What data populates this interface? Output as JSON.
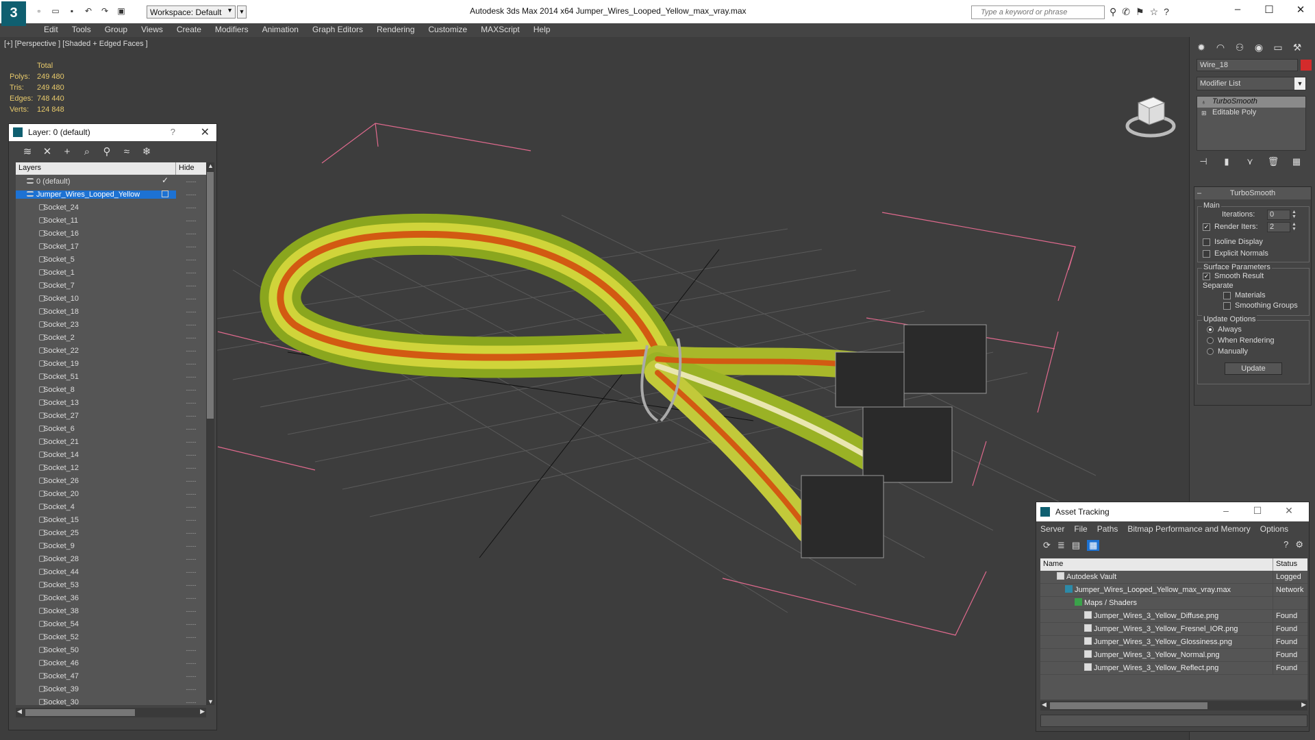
{
  "titlebar": {
    "workspace": "Workspace: Default",
    "app_title": "Autodesk 3ds Max  2014 x64       Jumper_Wires_Looped_Yellow_max_vray.max",
    "search_placeholder": "Type a keyword or phrase"
  },
  "menu": [
    "Edit",
    "Tools",
    "Group",
    "Views",
    "Create",
    "Modifiers",
    "Animation",
    "Graph Editors",
    "Rendering",
    "Customize",
    "MAXScript",
    "Help"
  ],
  "viewport": {
    "label": "[+] [Perspective ] [Shaded + Edged Faces ]",
    "stats": {
      "header": "Total",
      "polys_label": "Polys:",
      "polys": "249 480",
      "tris_label": "Tris:",
      "tris": "249 480",
      "edges_label": "Edges:",
      "edges": "748 440",
      "verts_label": "Verts:",
      "verts": "124 848"
    }
  },
  "layer_panel": {
    "title": "Layer: 0 (default)",
    "help": "?",
    "col_layers": "Layers",
    "col_hide": "Hide",
    "default_layer": "0 (default)",
    "selected_layer": "Jumper_Wires_Looped_Yellow",
    "hide_mark": "-----",
    "objects": [
      "Socket_24",
      "Socket_11",
      "Socket_16",
      "Socket_17",
      "Socket_5",
      "Socket_1",
      "Socket_7",
      "Socket_10",
      "Socket_18",
      "Socket_23",
      "Socket_2",
      "Socket_22",
      "Socket_19",
      "Socket_51",
      "Socket_8",
      "Socket_13",
      "Socket_27",
      "Socket_6",
      "Socket_21",
      "Socket_14",
      "Socket_12",
      "Socket_26",
      "Socket_20",
      "Socket_4",
      "Socket_15",
      "Socket_25",
      "Socket_9",
      "Socket_28",
      "Socket_44",
      "Socket_53",
      "Socket_36",
      "Socket_38",
      "Socket_54",
      "Socket_52",
      "Socket_50",
      "Socket_46",
      "Socket_47",
      "Socket_39",
      "Socket_30"
    ]
  },
  "command_panel": {
    "object_name": "Wire_18",
    "object_color": "#d42b2b",
    "modifier_list": "Modifier List",
    "stack": [
      "TurboSmooth",
      "Editable Poly"
    ],
    "rollout_title": "TurboSmooth",
    "main_group": "Main",
    "iterations_label": "Iterations:",
    "iterations": "0",
    "render_iters_label": "Render Iters:",
    "render_iters": "2",
    "isoline": "Isoline Display",
    "explicit": "Explicit Normals",
    "surface_group": "Surface Parameters",
    "smooth_result": "Smooth Result",
    "separate": "Separate",
    "materials": "Materials",
    "smoothing_groups": "Smoothing Groups",
    "update_group": "Update Options",
    "always": "Always",
    "when_rendering": "When Rendering",
    "manually": "Manually",
    "update_button": "Update"
  },
  "asset_tracking": {
    "title": "Asset Tracking",
    "menu": [
      "Server",
      "File",
      "Paths",
      "Bitmap Performance and Memory",
      "Options"
    ],
    "col_name": "Name",
    "col_status": "Status",
    "rows": [
      {
        "name": "Autodesk Vault",
        "status": "Logged"
      },
      {
        "name": "Jumper_Wires_Looped_Yellow_max_vray.max",
        "status": "Network"
      },
      {
        "name": "Maps / Shaders",
        "status": ""
      },
      {
        "name": "Jumper_Wires_3_Yellow_Diffuse.png",
        "status": "Found"
      },
      {
        "name": "Jumper_Wires_3_Yellow_Fresnel_IOR.png",
        "status": "Found"
      },
      {
        "name": "Jumper_Wires_3_Yellow_Glossiness.png",
        "status": "Found"
      },
      {
        "name": "Jumper_Wires_3_Yellow_Normal.png",
        "status": "Found"
      },
      {
        "name": "Jumper_Wires_3_Yellow_Reflect.png",
        "status": "Found"
      }
    ]
  }
}
